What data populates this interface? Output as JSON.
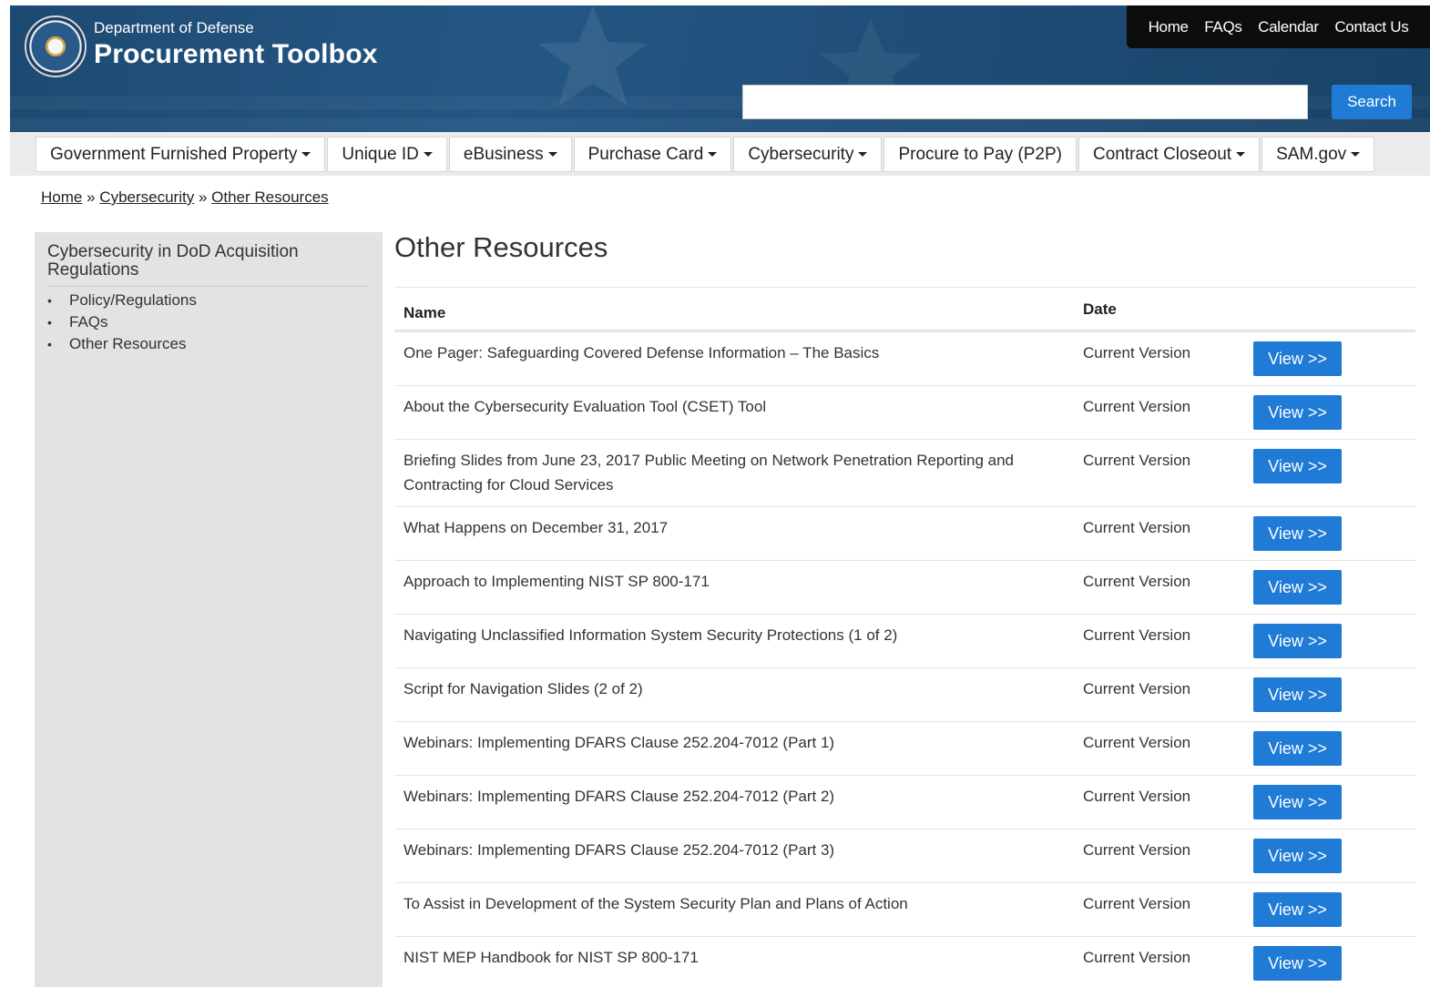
{
  "header": {
    "subtitle": "Department of Defense",
    "title": "Procurement Toolbox",
    "top_links": [
      "Home",
      "FAQs",
      "Calendar",
      "Contact Us"
    ],
    "search": {
      "value": "",
      "placeholder": "",
      "button_label": "Search"
    }
  },
  "nav": {
    "items": [
      {
        "label": "Government Furnished Property",
        "dropdown": true
      },
      {
        "label": "Unique ID",
        "dropdown": true
      },
      {
        "label": "eBusiness",
        "dropdown": true
      },
      {
        "label": "Purchase Card",
        "dropdown": true
      },
      {
        "label": "Cybersecurity",
        "dropdown": true
      },
      {
        "label": "Procure to Pay (P2P)",
        "dropdown": false
      },
      {
        "label": "Contract Closeout",
        "dropdown": true
      },
      {
        "label": "SAM.gov",
        "dropdown": true
      }
    ]
  },
  "breadcrumb": {
    "items": [
      "Home",
      "Cybersecurity",
      "Other Resources"
    ],
    "separator": "»"
  },
  "sidebar": {
    "title": "Cybersecurity in DoD Acquisition Regulations",
    "items": [
      "Policy/Regulations",
      "FAQs",
      "Other Resources"
    ]
  },
  "main": {
    "title": "Other Resources",
    "table": {
      "headers": {
        "name": "Name",
        "date": "Date"
      },
      "button_label": "View >>",
      "rows": [
        {
          "name": "One Pager: Safeguarding Covered Defense Information – The Basics",
          "date": "Current Version"
        },
        {
          "name": "About the Cybersecurity Evaluation Tool (CSET) Tool",
          "date": "Current Version"
        },
        {
          "name": "Briefing Slides from June 23, 2017 Public Meeting on Network Penetration Reporting and Contracting for Cloud Services",
          "date": "Current Version"
        },
        {
          "name": "What Happens on December 31, 2017",
          "date": "Current Version"
        },
        {
          "name": "Approach to Implementing NIST SP 800-171",
          "date": "Current Version"
        },
        {
          "name": "Navigating Unclassified Information System Security Protections (1 of 2)",
          "date": "Current Version"
        },
        {
          "name": "Script for Navigation Slides (2 of 2)",
          "date": "Current Version"
        },
        {
          "name": "Webinars: Implementing DFARS Clause 252.204-7012 (Part 1)",
          "date": "Current Version"
        },
        {
          "name": "Webinars: Implementing DFARS Clause 252.204-7012 (Part 2)",
          "date": "Current Version"
        },
        {
          "name": "Webinars: Implementing DFARS Clause 252.204-7012 (Part 3)",
          "date": "Current Version"
        },
        {
          "name": "To Assist in Development of the System Security Plan and Plans of Action",
          "date": "Current Version"
        },
        {
          "name": "NIST MEP Handbook for NIST SP 800-171",
          "date": "Current Version"
        }
      ]
    }
  },
  "colors": {
    "header_bg": "#1f4e79",
    "accent": "#1f7bd6",
    "toplinks_bg": "#0d0d0d",
    "sidebar_bg": "#e3e3e3",
    "nav_bg": "#ebebeb"
  },
  "icons": {
    "seal": "dod-seal-icon",
    "caret": "caret-down-icon"
  }
}
